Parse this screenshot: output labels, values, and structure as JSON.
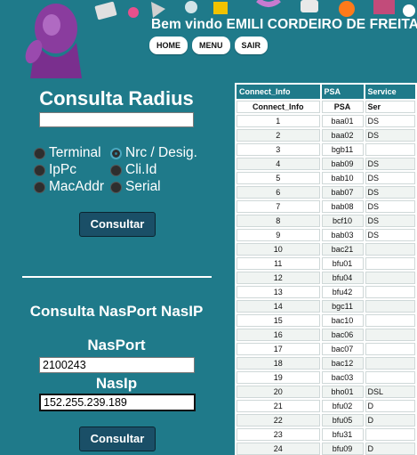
{
  "header": {
    "welcome": "Bem vindo EMILI CORDEIRO DE FREITAS",
    "nav": [
      "HOME",
      "MENU",
      "SAIR"
    ]
  },
  "radius": {
    "title": "Consulta Radius",
    "input_value": "",
    "options": [
      {
        "label": "Terminal",
        "checked": false
      },
      {
        "label": "Nrc / Desig.",
        "checked": true
      },
      {
        "label": "IpPc",
        "checked": false
      },
      {
        "label": "Cli.Id",
        "checked": false
      },
      {
        "label": "MacAddr",
        "checked": false
      },
      {
        "label": "Serial",
        "checked": false
      }
    ],
    "button": "Consultar"
  },
  "nas": {
    "title": "Consulta NasPort NasIP",
    "nasport_label": "NasPort",
    "nasport_value": "2100243",
    "nasip_label": "NasIp",
    "nasip_value": "152.255.239.189",
    "button": "Consultar"
  },
  "table": {
    "headers": [
      "Connect_Info",
      "PSA",
      "Service"
    ],
    "subheaders": [
      "Connect_Info",
      "PSA",
      "Ser"
    ],
    "rows": [
      [
        "1",
        "baa01",
        "DS"
      ],
      [
        "2",
        "baa02",
        "DS"
      ],
      [
        "3",
        "bgb11",
        ""
      ],
      [
        "4",
        "bab09",
        "DS"
      ],
      [
        "5",
        "bab10",
        "DS"
      ],
      [
        "6",
        "bab07",
        "DS"
      ],
      [
        "7",
        "bab08",
        "DS"
      ],
      [
        "8",
        "bcf10",
        "DS"
      ],
      [
        "9",
        "bab03",
        "DS"
      ],
      [
        "10",
        "bac21",
        ""
      ],
      [
        "11",
        "bfu01",
        ""
      ],
      [
        "12",
        "bfu04",
        ""
      ],
      [
        "13",
        "bfu42",
        ""
      ],
      [
        "14",
        "bgc11",
        ""
      ],
      [
        "15",
        "bac10",
        ""
      ],
      [
        "16",
        "bac06",
        ""
      ],
      [
        "17",
        "bac07",
        ""
      ],
      [
        "18",
        "bac12",
        ""
      ],
      [
        "19",
        "bac03",
        ""
      ],
      [
        "20",
        "bho01",
        "DSL"
      ],
      [
        "21",
        "bfu02",
        "D"
      ],
      [
        "22",
        "bfu05",
        "D"
      ],
      [
        "23",
        "bfu31",
        ""
      ],
      [
        "24",
        "bfu09",
        "D"
      ]
    ]
  }
}
